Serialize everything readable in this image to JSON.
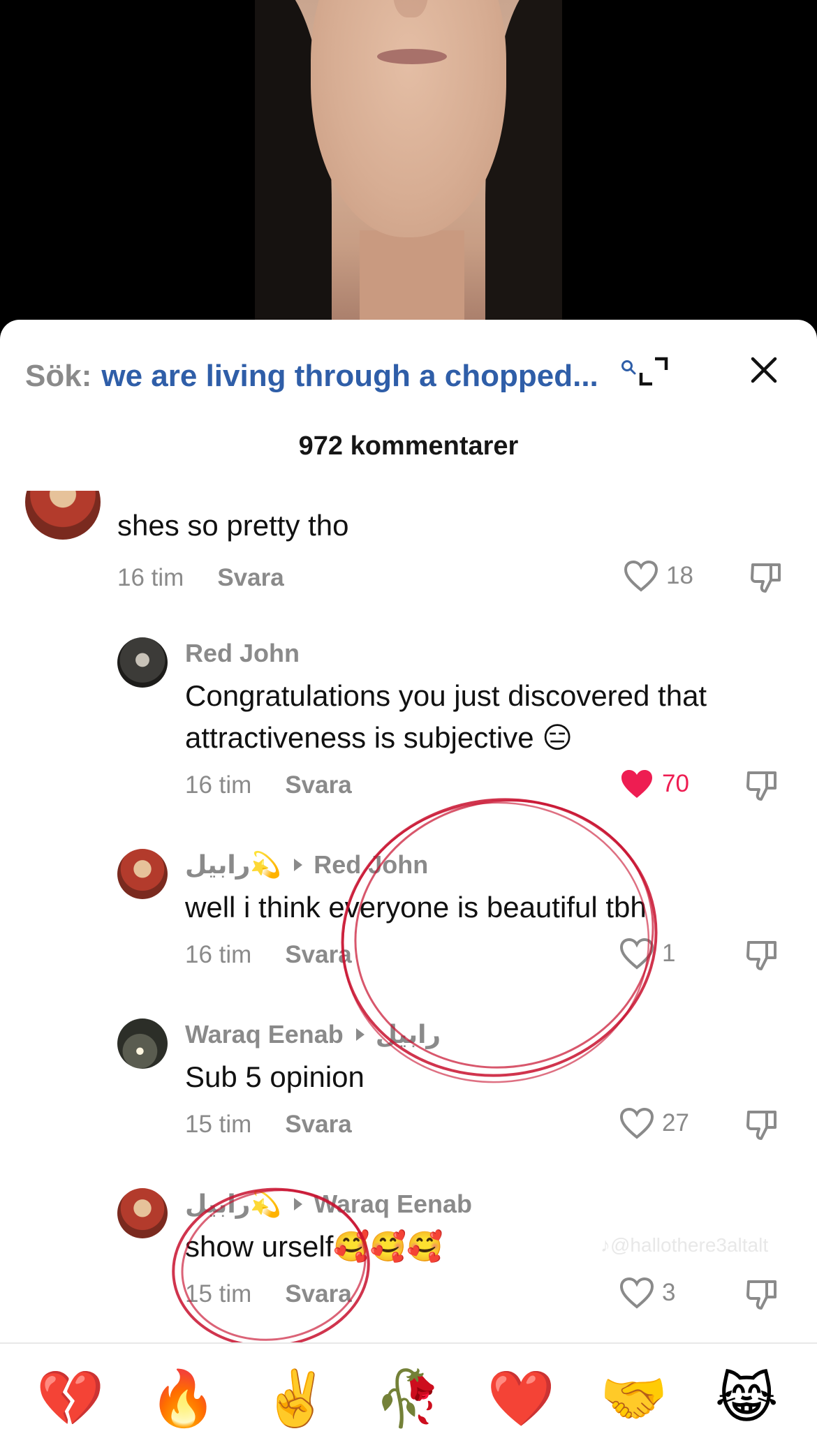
{
  "search": {
    "prefix": "Sök:",
    "query": "we are living through a chopped..."
  },
  "header": {
    "comment_count": "972 kommentarer"
  },
  "comments": [
    {
      "user": "",
      "text": "shes so pretty tho",
      "time": "16 tim",
      "reply": "Svara",
      "likes": "18",
      "liked": false
    },
    {
      "user": "Red John",
      "text": "Congratulations you just discovered that attractiveness is subjective 😑",
      "time": "16 tim",
      "reply": "Svara",
      "likes": "70",
      "liked": true
    },
    {
      "user": "رابيل💫",
      "reply_to": "Red John",
      "text": "well i think everyone is beautiful tbh",
      "time": "16 tim",
      "reply": "Svara",
      "likes": "1",
      "liked": false
    },
    {
      "user": "Waraq Eenab",
      "reply_to": "رابيل",
      "text": "Sub 5 opinion",
      "time": "15 tim",
      "reply": "Svara",
      "likes": "27",
      "liked": false
    },
    {
      "user": "رابيل💫",
      "reply_to": "Waraq Eenab",
      "text": "show urself🥰🥰🥰",
      "time": "15 tim",
      "reply": "Svara",
      "likes": "3",
      "liked": false
    }
  ],
  "watermark": "♪@hallothere3altalt",
  "emoji_bar": [
    "💔",
    "🔥",
    "✌️",
    "🥀",
    "❤️",
    "🤝",
    "😹"
  ],
  "colors": {
    "query_blue": "#2f5ea8",
    "like_red": "#ee1d52",
    "annotation_red": "#c8102e"
  }
}
